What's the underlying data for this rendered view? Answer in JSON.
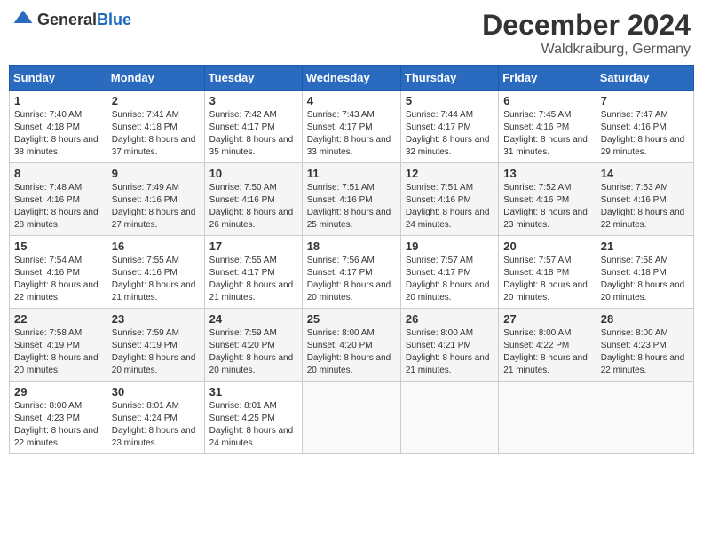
{
  "header": {
    "logo_general": "General",
    "logo_blue": "Blue",
    "month_year": "December 2024",
    "location": "Waldkraiburg, Germany"
  },
  "days_of_week": [
    "Sunday",
    "Monday",
    "Tuesday",
    "Wednesday",
    "Thursday",
    "Friday",
    "Saturday"
  ],
  "weeks": [
    [
      {
        "day": 1,
        "sunrise": "7:40 AM",
        "sunset": "4:18 PM",
        "daylight": "8 hours and 38 minutes."
      },
      {
        "day": 2,
        "sunrise": "7:41 AM",
        "sunset": "4:18 PM",
        "daylight": "8 hours and 37 minutes."
      },
      {
        "day": 3,
        "sunrise": "7:42 AM",
        "sunset": "4:17 PM",
        "daylight": "8 hours and 35 minutes."
      },
      {
        "day": 4,
        "sunrise": "7:43 AM",
        "sunset": "4:17 PM",
        "daylight": "8 hours and 33 minutes."
      },
      {
        "day": 5,
        "sunrise": "7:44 AM",
        "sunset": "4:17 PM",
        "daylight": "8 hours and 32 minutes."
      },
      {
        "day": 6,
        "sunrise": "7:45 AM",
        "sunset": "4:16 PM",
        "daylight": "8 hours and 31 minutes."
      },
      {
        "day": 7,
        "sunrise": "7:47 AM",
        "sunset": "4:16 PM",
        "daylight": "8 hours and 29 minutes."
      }
    ],
    [
      {
        "day": 8,
        "sunrise": "7:48 AM",
        "sunset": "4:16 PM",
        "daylight": "8 hours and 28 minutes."
      },
      {
        "day": 9,
        "sunrise": "7:49 AM",
        "sunset": "4:16 PM",
        "daylight": "8 hours and 27 minutes."
      },
      {
        "day": 10,
        "sunrise": "7:50 AM",
        "sunset": "4:16 PM",
        "daylight": "8 hours and 26 minutes."
      },
      {
        "day": 11,
        "sunrise": "7:51 AM",
        "sunset": "4:16 PM",
        "daylight": "8 hours and 25 minutes."
      },
      {
        "day": 12,
        "sunrise": "7:51 AM",
        "sunset": "4:16 PM",
        "daylight": "8 hours and 24 minutes."
      },
      {
        "day": 13,
        "sunrise": "7:52 AM",
        "sunset": "4:16 PM",
        "daylight": "8 hours and 23 minutes."
      },
      {
        "day": 14,
        "sunrise": "7:53 AM",
        "sunset": "4:16 PM",
        "daylight": "8 hours and 22 minutes."
      }
    ],
    [
      {
        "day": 15,
        "sunrise": "7:54 AM",
        "sunset": "4:16 PM",
        "daylight": "8 hours and 22 minutes."
      },
      {
        "day": 16,
        "sunrise": "7:55 AM",
        "sunset": "4:16 PM",
        "daylight": "8 hours and 21 minutes."
      },
      {
        "day": 17,
        "sunrise": "7:55 AM",
        "sunset": "4:17 PM",
        "daylight": "8 hours and 21 minutes."
      },
      {
        "day": 18,
        "sunrise": "7:56 AM",
        "sunset": "4:17 PM",
        "daylight": "8 hours and 20 minutes."
      },
      {
        "day": 19,
        "sunrise": "7:57 AM",
        "sunset": "4:17 PM",
        "daylight": "8 hours and 20 minutes."
      },
      {
        "day": 20,
        "sunrise": "7:57 AM",
        "sunset": "4:18 PM",
        "daylight": "8 hours and 20 minutes."
      },
      {
        "day": 21,
        "sunrise": "7:58 AM",
        "sunset": "4:18 PM",
        "daylight": "8 hours and 20 minutes."
      }
    ],
    [
      {
        "day": 22,
        "sunrise": "7:58 AM",
        "sunset": "4:19 PM",
        "daylight": "8 hours and 20 minutes."
      },
      {
        "day": 23,
        "sunrise": "7:59 AM",
        "sunset": "4:19 PM",
        "daylight": "8 hours and 20 minutes."
      },
      {
        "day": 24,
        "sunrise": "7:59 AM",
        "sunset": "4:20 PM",
        "daylight": "8 hours and 20 minutes."
      },
      {
        "day": 25,
        "sunrise": "8:00 AM",
        "sunset": "4:20 PM",
        "daylight": "8 hours and 20 minutes."
      },
      {
        "day": 26,
        "sunrise": "8:00 AM",
        "sunset": "4:21 PM",
        "daylight": "8 hours and 21 minutes."
      },
      {
        "day": 27,
        "sunrise": "8:00 AM",
        "sunset": "4:22 PM",
        "daylight": "8 hours and 21 minutes."
      },
      {
        "day": 28,
        "sunrise": "8:00 AM",
        "sunset": "4:23 PM",
        "daylight": "8 hours and 22 minutes."
      }
    ],
    [
      {
        "day": 29,
        "sunrise": "8:00 AM",
        "sunset": "4:23 PM",
        "daylight": "8 hours and 22 minutes."
      },
      {
        "day": 30,
        "sunrise": "8:01 AM",
        "sunset": "4:24 PM",
        "daylight": "8 hours and 23 minutes."
      },
      {
        "day": 31,
        "sunrise": "8:01 AM",
        "sunset": "4:25 PM",
        "daylight": "8 hours and 24 minutes."
      },
      null,
      null,
      null,
      null
    ]
  ]
}
